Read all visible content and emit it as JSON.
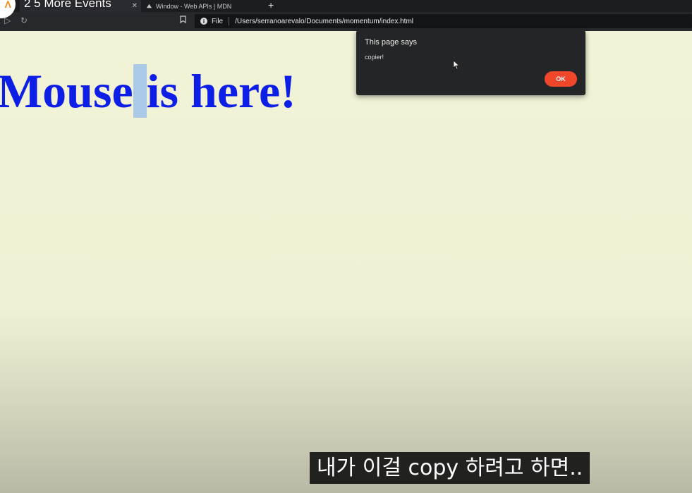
{
  "video": {
    "title": "2 5 More Events",
    "channel_icon": "nomad-logo-icon",
    "subtitle": "내가 이걸 copy 하려고 하면.."
  },
  "browser": {
    "tabs": [
      {
        "label": "",
        "active": true,
        "icon": "page-icon"
      },
      {
        "label": "Window - Web APIs | MDN",
        "active": false,
        "icon": "mdn-icon"
      }
    ],
    "new_tab_label": "+",
    "address": {
      "scheme_label": "File",
      "url": "/Users/serranoarevalo/Documents/momentum/index.html"
    }
  },
  "page": {
    "heading_before": "Mouse",
    "heading_selected": " ",
    "heading_after": "is here!",
    "background_color": "#f2f3d6",
    "heading_color": "#0d1fe6"
  },
  "alert": {
    "title": "This page says",
    "message": "copier!",
    "ok_label": "OK",
    "ok_color": "#f0472a"
  }
}
